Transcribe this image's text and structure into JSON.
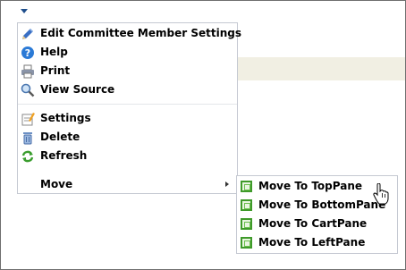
{
  "menu": {
    "items": [
      {
        "label": "Edit Committee Member Settings",
        "icon": "pencil-icon"
      },
      {
        "label": "Help",
        "icon": "help-icon"
      },
      {
        "label": "Print",
        "icon": "printer-icon"
      },
      {
        "label": "View Source",
        "icon": "magnifier-icon"
      },
      {
        "label": "Settings",
        "icon": "settings-icon"
      },
      {
        "label": "Delete",
        "icon": "trash-icon"
      },
      {
        "label": "Refresh",
        "icon": "refresh-icon"
      },
      {
        "label": "Move",
        "icon": "submenu-arrow-icon"
      }
    ]
  },
  "submenu": {
    "items": [
      {
        "label": "Move To TopPane",
        "icon": "pane-icon"
      },
      {
        "label": "Move To BottomPane",
        "icon": "pane-icon"
      },
      {
        "label": "Move To CartPane",
        "icon": "pane-icon"
      },
      {
        "label": "Move To LeftPane",
        "icon": "pane-icon"
      }
    ]
  },
  "colors": {
    "menu_border": "#c5c9d2",
    "trigger_arrow": "#1f4e8c",
    "pane_icon_green": "#3f9a2a",
    "band": "#f1efe3"
  }
}
